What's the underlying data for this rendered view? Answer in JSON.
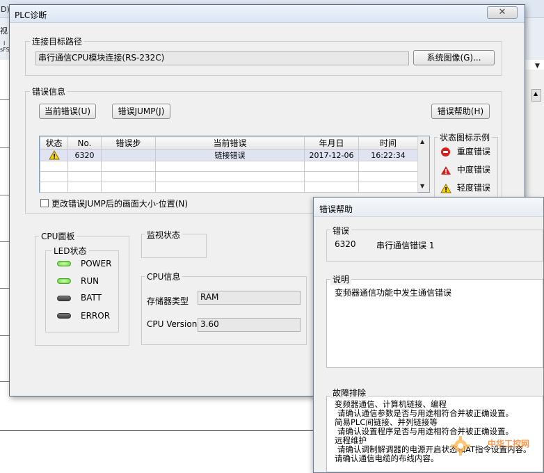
{
  "background": {
    "bg_mark_d": "D)",
    "bg_mark_1": "视",
    "bg_mark_2": "I",
    "bg_mark_3": "sFS",
    "bg_dropdown_arrow": "▼",
    "bg_scroll_arrow": "▲"
  },
  "plc_dialog": {
    "title": "PLC诊断",
    "close_icon": "✕",
    "connection": {
      "group_label": "连接目标路径",
      "path_value": "串行通信CPU模块连接(RS-232C)",
      "system_image_button": "系统图像(G)..."
    },
    "error_info": {
      "group_label": "错误信息",
      "current_error_button": "当前错误(U)",
      "error_jump_button": "错误JUMP(J)",
      "error_help_button": "错误帮助(H)",
      "table": {
        "headers": [
          "状态",
          "No.",
          "错误步",
          "当前错误",
          "年月日",
          "时间"
        ],
        "rows": [
          {
            "status_icon": "warning-icon",
            "no": "6320",
            "step": "",
            "error": "链接错误",
            "date": "2017-12-06",
            "time": "16:22:34"
          }
        ]
      },
      "checkbox_label": "更改错误JUMP后的画面大小·位置(N)",
      "legend": {
        "label": "状态图标示例",
        "items": [
          {
            "icon": "heavy-error-icon",
            "label": "重度错误",
            "color": "#d91d1d"
          },
          {
            "icon": "medium-error-icon",
            "label": "中度错误",
            "color": "#d91d1d"
          },
          {
            "icon": "light-error-icon",
            "label": "轻度错误",
            "color": "#f2d400"
          }
        ]
      }
    },
    "cpu_panel": {
      "label": "CPU面板",
      "led_status_label": "LED状态",
      "leds": [
        {
          "name": "POWER",
          "on": true
        },
        {
          "name": "RUN",
          "on": true
        },
        {
          "name": "BATT",
          "on": false
        },
        {
          "name": "ERROR",
          "on": false
        }
      ]
    },
    "monitor_status": {
      "label": "监视状态"
    },
    "cpu_info": {
      "label": "CPU信息",
      "memory_type_label": "存储器类型",
      "memory_type_value": "RAM",
      "cpu_version_label": "CPU Version",
      "cpu_version_value": "3.60"
    }
  },
  "help_dialog": {
    "title": "错误帮助",
    "error_section": {
      "label": "错误",
      "code": "6320",
      "message": "串行通信错误 1"
    },
    "description_section": {
      "label": "说明",
      "text": "变频器通信功能中发生通信错误"
    },
    "troubleshoot_section": {
      "label": "故障排除",
      "lines": [
        "变频器通信、计算机链接、编程",
        "请确认通信参数是否与用途相符合并被正确设置。",
        "简易PLC间链接、并列链接等",
        "请确认设置程序是否与用途相符合并被正确设置。",
        "远程维护",
        "请确认调制解调器的电源开启状态和AT指令设置内容。",
        "请确认通信电缆的布线内容。"
      ]
    },
    "watermark": "中华工控网"
  }
}
